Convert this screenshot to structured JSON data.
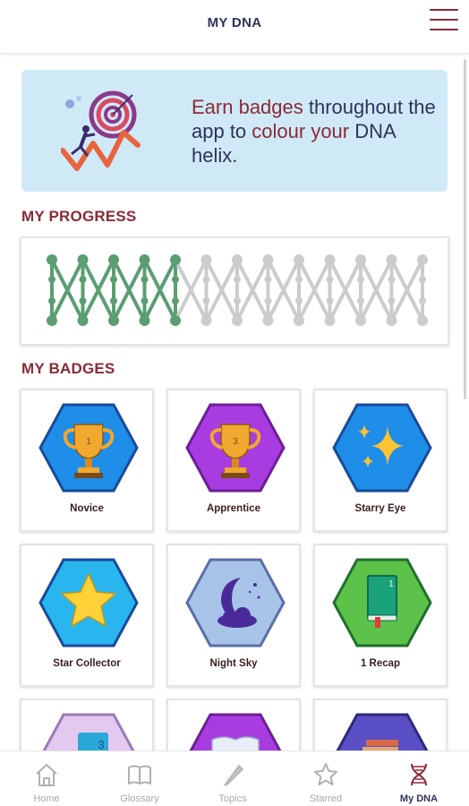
{
  "header": {
    "title": "MY DNA"
  },
  "banner": {
    "pre": "Earn badges",
    "mid1": " throughout the app to ",
    "hl2": "colour your",
    "post": " DNA helix."
  },
  "progress": {
    "title": "MY PROGRESS",
    "fraction_coloured": 0.37
  },
  "badges_section": {
    "title": "MY BADGES",
    "items": [
      {
        "label": "Novice",
        "icon": "trophy-icon",
        "hex_fill": "#1e8ee8",
        "hex_border": "#1a4a9a"
      },
      {
        "label": "Apprentice",
        "icon": "trophy-icon",
        "hex_fill": "#a93ce0",
        "hex_border": "#6b1f96"
      },
      {
        "label": "Starry Eye",
        "icon": "sparkle-icon",
        "hex_fill": "#1e8ee8",
        "hex_border": "#1a4a9a"
      },
      {
        "label": "Star Collector",
        "icon": "star-icon",
        "hex_fill": "#29b6ee",
        "hex_border": "#1a4a9a"
      },
      {
        "label": "Night Sky",
        "icon": "moon-icon",
        "hex_fill": "#a8c3e8",
        "hex_border": "#5a6fa8"
      },
      {
        "label": "1 Recap",
        "icon": "book-icon",
        "hex_fill": "#5cc24a",
        "hex_border": "#1f6f2e"
      },
      {
        "label": "",
        "icon": "cards-icon",
        "hex_fill": "#e3c8f0",
        "hex_border": "#9b7ab8"
      },
      {
        "label": "",
        "icon": "open-book-icon",
        "hex_fill": "#a93ce0",
        "hex_border": "#6b1f96"
      },
      {
        "label": "",
        "icon": "books-stack-icon",
        "hex_fill": "#5a4fc4",
        "hex_border": "#2e2a7a"
      }
    ]
  },
  "nav": {
    "items": [
      {
        "label": "Home",
        "icon": "home-icon"
      },
      {
        "label": "Glossary",
        "icon": "book-outline-icon"
      },
      {
        "label": "Topics",
        "icon": "pencil-icon"
      },
      {
        "label": "Starred",
        "icon": "star-outline-icon"
      },
      {
        "label": "My DNA",
        "icon": "dna-icon"
      }
    ]
  },
  "colors": {
    "accent": "#8b2a36",
    "navy": "#2e3358",
    "dna_green": "#5a9e72",
    "dna_grey": "#cccccc"
  }
}
